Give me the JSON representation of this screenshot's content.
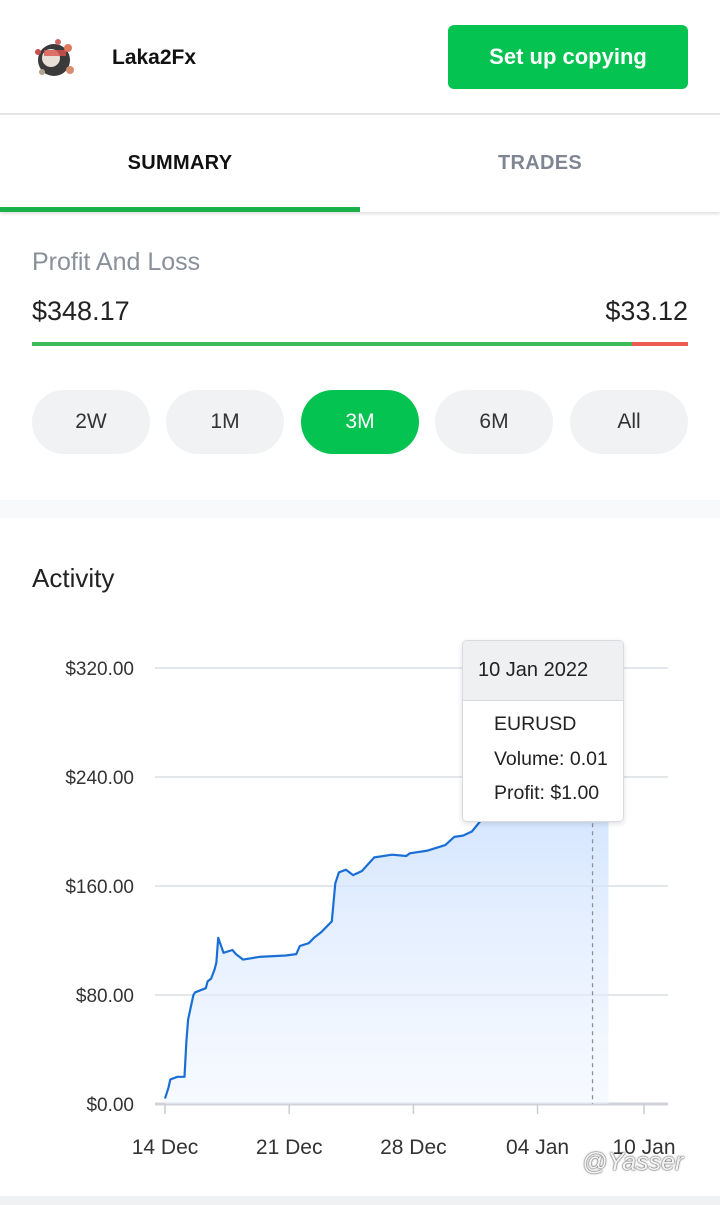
{
  "header": {
    "trader_name": "Laka2Fx",
    "copy_button": "Set up copying",
    "avatar_icon": "trader-avatar-icon"
  },
  "tabs": [
    {
      "label": "SUMMARY",
      "active": true
    },
    {
      "label": "TRADES",
      "active": false
    }
  ],
  "profit_and_loss": {
    "label": "Profit And Loss",
    "profit": "$348.17",
    "loss": "$33.12"
  },
  "periods": [
    {
      "label": "2W",
      "active": false
    },
    {
      "label": "1M",
      "active": false
    },
    {
      "label": "3M",
      "active": true
    },
    {
      "label": "6M",
      "active": false
    },
    {
      "label": "All",
      "active": false
    }
  ],
  "activity": {
    "title": "Activity"
  },
  "tooltip": {
    "date": "10 Jan 2022",
    "symbol": "EURUSD",
    "volume": "Volume: 0.01",
    "profit": "Profit: $1.00"
  },
  "watermark": "@Yasser",
  "colors": {
    "accent_green": "#05c350",
    "tab_underline": "#1ab04a",
    "loss_red": "#ee5a4f",
    "line_blue": "#1a6fd6",
    "area_fill": "#cfe2ff"
  },
  "chart_data": {
    "type": "area",
    "ylim": [
      0,
      320
    ],
    "y_ticks": [
      "$0.00",
      "$80.00",
      "$160.00",
      "$240.00",
      "$320.00"
    ],
    "x_ticks": [
      "14 Dec",
      "21 Dec",
      "28 Dec",
      "04 Jan",
      "10 Jan"
    ],
    "x": [
      13.2,
      13.4,
      13.5,
      13.9,
      14.3,
      14.4,
      14.5,
      14.8,
      14.9,
      15.5,
      15.6,
      15.8,
      16.0,
      16.1,
      16.2,
      16.5,
      17.0,
      17.2,
      17.6,
      18.5,
      20.0,
      20.6,
      20.8,
      21.3,
      21.6,
      22.0,
      22.6,
      22.8,
      23.0,
      23.4,
      23.8,
      24.3,
      25.0,
      26.0,
      26.8,
      27.0,
      28.0,
      29.0,
      29.5,
      30.0,
      30.5,
      31.0,
      31.5,
      32.5,
      33.5,
      34.5,
      35.5,
      36.5,
      36.8,
      37.2,
      37.8,
      38.0,
      38.2
    ],
    "values": [
      4,
      12,
      18,
      20,
      20,
      45,
      62,
      80,
      82,
      85,
      90,
      92,
      99,
      104,
      122,
      111,
      113,
      110,
      106,
      108,
      109,
      110,
      116,
      118,
      122,
      126,
      134,
      162,
      170,
      172,
      168,
      171,
      181,
      183,
      182,
      184,
      186,
      190,
      196,
      197,
      200,
      208,
      236,
      242,
      250,
      276,
      282,
      294,
      296,
      299,
      306,
      308,
      312
    ],
    "highlight": {
      "x": 37.3,
      "value": 300
    }
  }
}
